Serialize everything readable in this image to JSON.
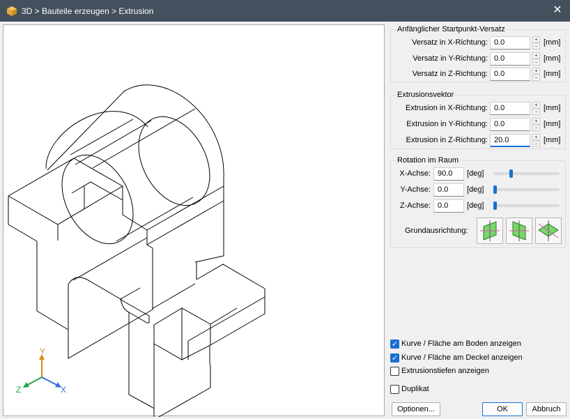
{
  "window": {
    "title": "3D > Bauteile erzeugen > Extrusion",
    "close_symbol": "✕"
  },
  "offset_group": {
    "title": "Anfänglicher Startpunkt-Versatz",
    "rows": [
      {
        "label": "Versatz in X-Richtung:",
        "value": "0.0",
        "unit": "[mm]"
      },
      {
        "label": "Versatz in Y-Richtung:",
        "value": "0.0",
        "unit": "[mm]"
      },
      {
        "label": "Versatz in Z-Richtung:",
        "value": "0.0",
        "unit": "[mm]"
      }
    ]
  },
  "vector_group": {
    "title": "Extrusionsvektor",
    "rows": [
      {
        "label": "Extrusion in X-Richtung:",
        "value": "0.0",
        "unit": "[mm]"
      },
      {
        "label": "Extrusion in Y-Richtung:",
        "value": "0.0",
        "unit": "[mm]"
      },
      {
        "label": "Extrusion in Z-Richtung:",
        "value": "20.0",
        "unit": "[mm]"
      }
    ]
  },
  "rotation_group": {
    "title": "Rotation im Raum",
    "rows": [
      {
        "label": "X-Achse:",
        "value": "90.0",
        "unit": "[deg]",
        "slider_fraction": 0.25
      },
      {
        "label": "Y-Achse:",
        "value": "0.0",
        "unit": "[deg]",
        "slider_fraction": 0.0
      },
      {
        "label": "Z-Achse:",
        "value": "0.0",
        "unit": "[deg]",
        "slider_fraction": 0.0
      }
    ],
    "orientation_label": "Grundausrichtung:",
    "orientation_buttons": [
      "orientation-xz-icon",
      "orientation-yz-icon",
      "orientation-xy-icon"
    ]
  },
  "options": [
    {
      "label": "Kurve / Fläche am Boden anzeigen",
      "checked": true
    },
    {
      "label": "Kurve / Fläche am Deckel anzeigen",
      "checked": true
    },
    {
      "label": "Extrusionstiefen anzeigen",
      "checked": false
    }
  ],
  "duplicate": {
    "label": "Duplikat",
    "checked": false
  },
  "buttons": {
    "options": "Optionen...",
    "ok": "OK",
    "cancel": "Abbruch"
  },
  "axes": {
    "x": "X",
    "y": "Y",
    "z": "Z"
  },
  "colors": {
    "titlebar": "#44505e",
    "accent": "#1a6fd0",
    "axis_x": "#3a6fd8",
    "axis_y": "#e08a1a",
    "axis_z": "#1fa34a"
  }
}
